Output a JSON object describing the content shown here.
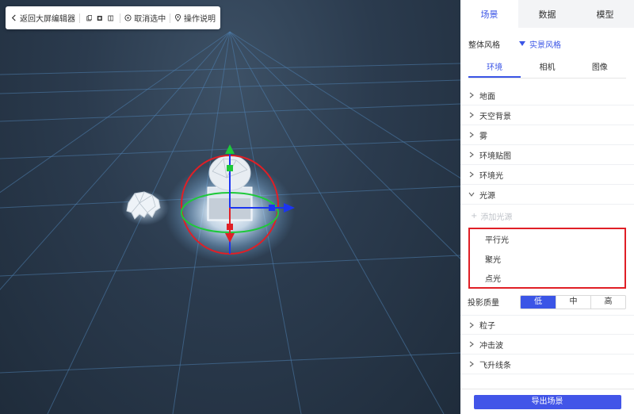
{
  "toolbar": {
    "back_label": "返回大屏编辑器",
    "deselect_label": "取消选中",
    "guide_label": "操作说明"
  },
  "panel": {
    "top_tabs": [
      "场景",
      "数据",
      "模型"
    ],
    "style_row": {
      "label": "整体风格",
      "value": "实景风格"
    },
    "sub_tabs": [
      "环境",
      "相机",
      "图像"
    ],
    "sections_before": [
      "地面",
      "天空背景",
      "雾",
      "环境贴图",
      "环境光"
    ],
    "light_section": "光源",
    "add_light_label": "添加光源",
    "light_types": [
      "平行光",
      "聚光",
      "点光"
    ],
    "quality": {
      "label": "投影质量",
      "options": [
        "低",
        "中",
        "高"
      ],
      "selected": "低"
    },
    "sections_after": [
      "粒子",
      "冲击波",
      "飞升线条"
    ],
    "export_label": "导出场景"
  },
  "colors": {
    "accent": "#3b55e6",
    "highlight_border": "#e01f26",
    "gizmo_x": "#1c35f0",
    "gizmo_y": "#1ec93a",
    "gizmo_z": "#e01f26"
  }
}
